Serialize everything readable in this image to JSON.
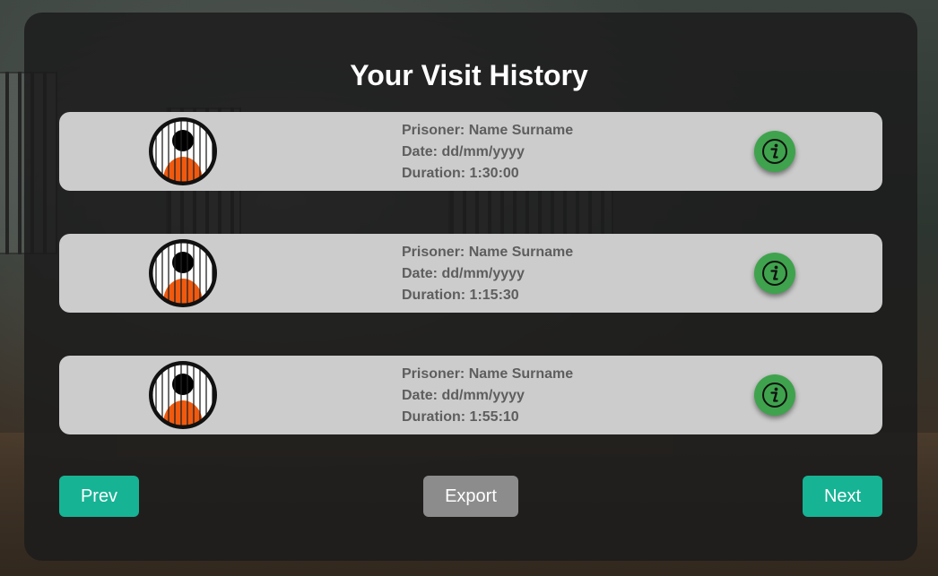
{
  "page": {
    "title": "Your Visit History"
  },
  "visits": [
    {
      "prisoner": "Prisoner: Name Surname",
      "date": "Date: dd/mm/yyyy",
      "duration": "Duration: 1:30:00"
    },
    {
      "prisoner": "Prisoner: Name Surname",
      "date": "Date: dd/mm/yyyy",
      "duration": "Duration: 1:15:30"
    },
    {
      "prisoner": "Prisoner: Name Surname",
      "date": "Date: dd/mm/yyyy",
      "duration": "Duration: 1:55:10"
    }
  ],
  "buttons": {
    "prev": "Prev",
    "export": "Export",
    "next": "Next"
  },
  "icons": {
    "avatar": "prisoner-avatar-icon",
    "info": "info-icon"
  },
  "colors": {
    "accent": "#16b394",
    "info_button": "#3fa34d",
    "export_button": "#8c8c8c",
    "card": "#cccccc",
    "card_text": "#5e5e5e",
    "prisoner_uniform": "#f05a0f"
  }
}
